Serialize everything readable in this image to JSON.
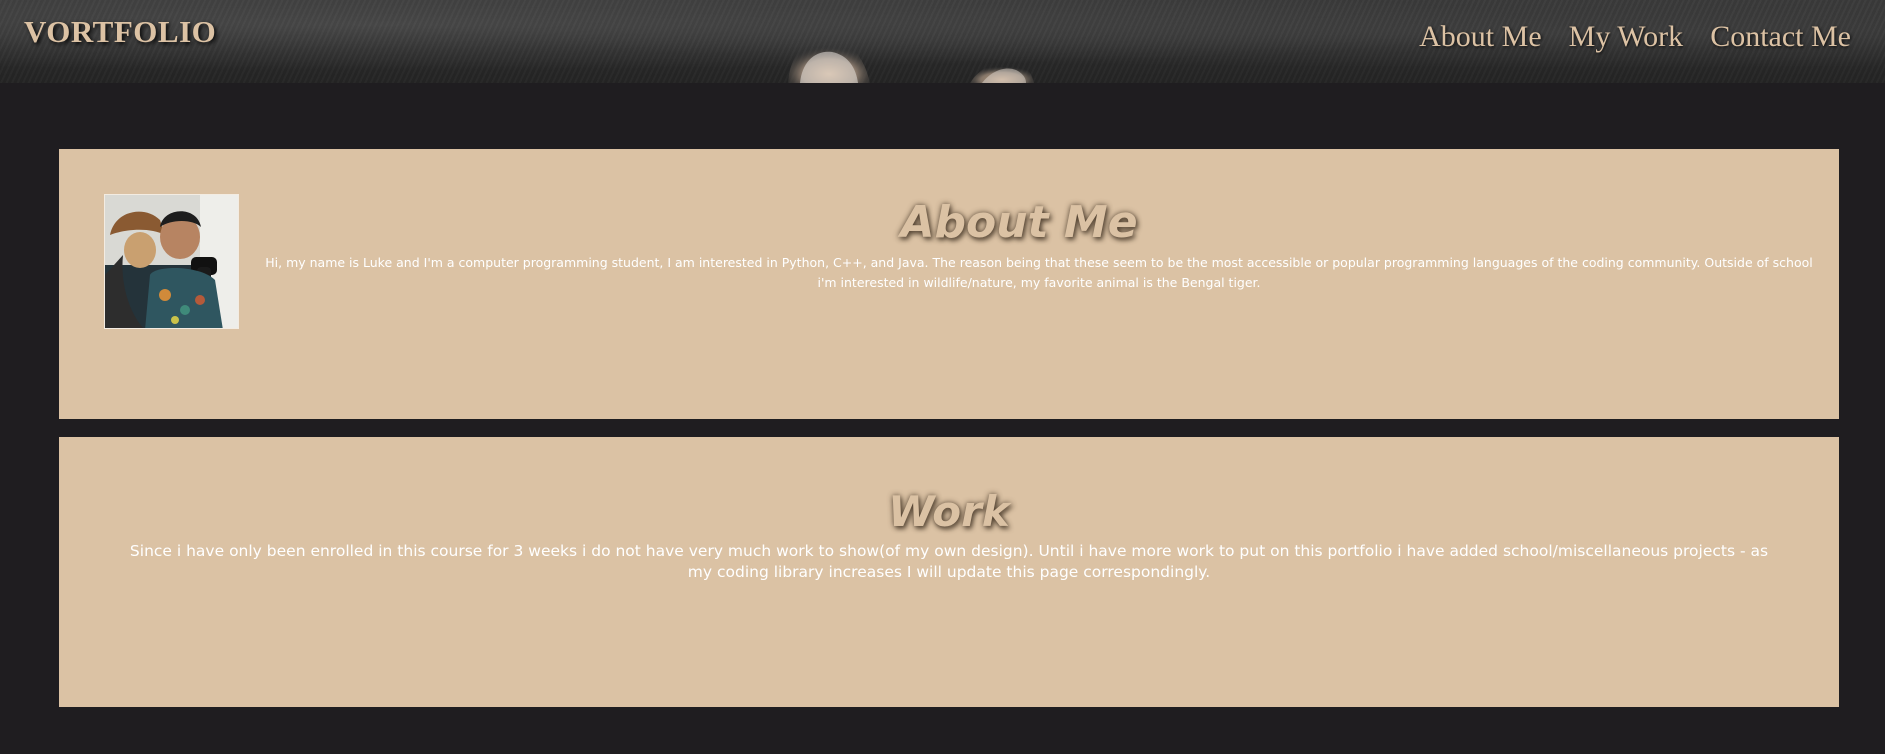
{
  "header": {
    "brand": "VORTFOLIO",
    "nav": [
      {
        "label": "About Me"
      },
      {
        "label": "My Work"
      },
      {
        "label": "Contact Me"
      }
    ]
  },
  "about": {
    "title": "About Me",
    "body": "Hi, my name is Luke and I'm a computer programming student, I am interested in Python, C++, and Java. The reason being that these seem to be the most accessible or popular programming languages of the coding community. Outside of school i'm interested in wildlife/nature, my favorite animal is the Bengal tiger."
  },
  "work": {
    "title": "Work",
    "body": "Since i have only been enrolled in this course for 3 weeks i do not have very much work to show(of my own design). Until i have more work to put on this portfolio i have added school/miscellaneous projects - as my coding library increases I will update this page correspondingly."
  },
  "colors": {
    "page_background": "#1f1d20",
    "panel_background": "#dbc2a4",
    "accent_text": "#dcc2a4",
    "body_text": "#ffffff"
  }
}
